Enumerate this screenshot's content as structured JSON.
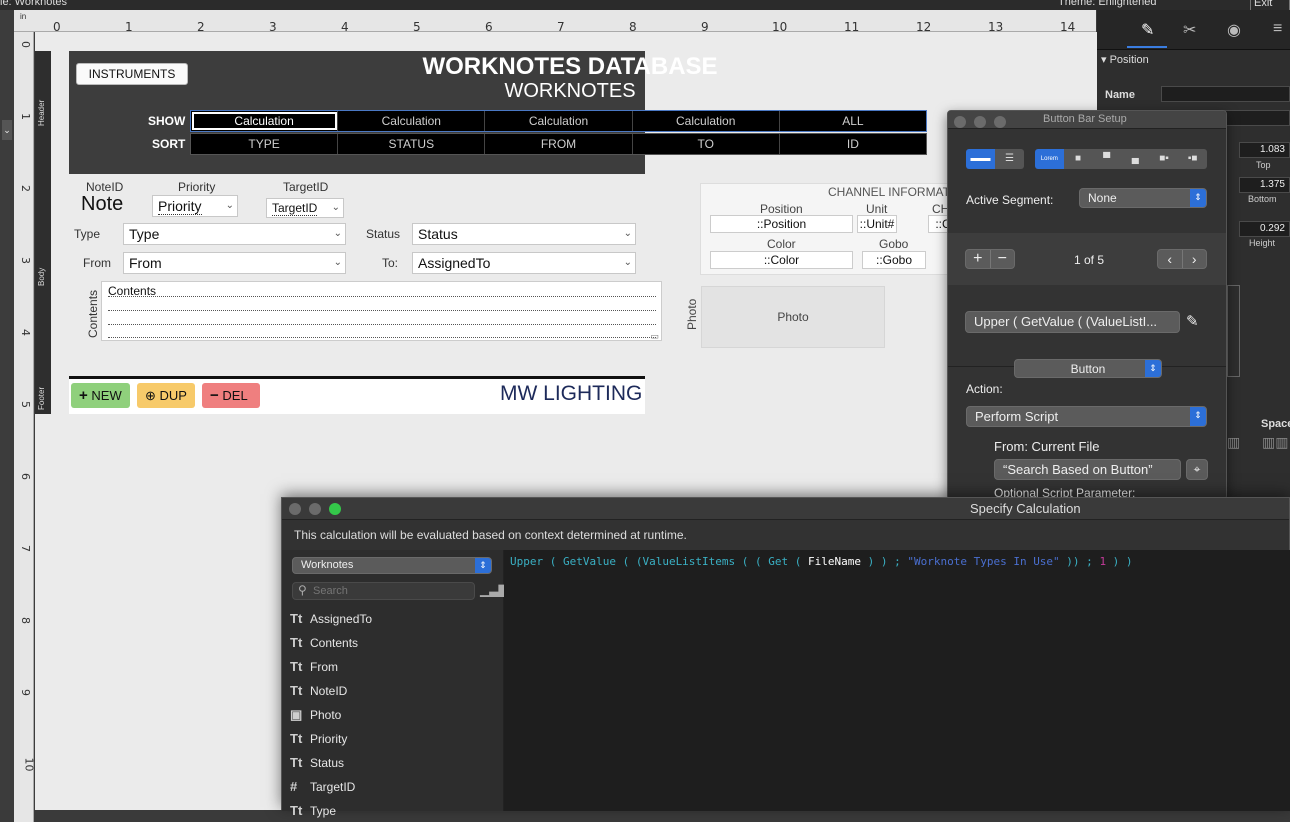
{
  "topbar": {
    "left_text": "le: Worknotes",
    "right_text": "Theme: Enlightened",
    "exit_label": "Exit La"
  },
  "ruler": {
    "unit": "in",
    "h_ticks": [
      "0",
      "1",
      "2",
      "3",
      "4",
      "5",
      "6",
      "7",
      "8",
      "9",
      "10",
      "11",
      "12",
      "13",
      "14"
    ],
    "v_ticks": [
      "0",
      "1",
      "2",
      "3",
      "4",
      "5",
      "6",
      "7",
      "8",
      "9",
      "10"
    ]
  },
  "parts": {
    "header": "Header",
    "body": "Body",
    "footer": "Footer"
  },
  "layout": {
    "instruments_label": "INSTRUMENTS",
    "title": "WORKNOTES DATABASE",
    "subtitle": "WORKNOTES",
    "show_label": "SHOW",
    "sort_label": "SORT",
    "show_buttons": [
      "Calculation",
      "Calculation",
      "Calculation",
      "Calculation",
      "ALL"
    ],
    "sort_buttons": [
      "TYPE",
      "STATUS",
      "FROM",
      "TO",
      "ID"
    ],
    "fields": {
      "noteid_label": "NoteID",
      "note_value": "Note",
      "priority_label": "Priority",
      "priority_value": "Priority",
      "targetid_label": "TargetID",
      "targetid_value": "TargetID",
      "type_label": "Type",
      "type_value": "Type",
      "status_label": "Status",
      "status_value": "Status",
      "from_label": "From",
      "from_value": "From",
      "to_label": "To:",
      "to_value": "AssignedTo",
      "contents_label": "Contents",
      "contents_value": "Contents"
    },
    "channel": {
      "title": "CHANNEL INFORMAT",
      "position_label": "Position",
      "position_value": "::Position",
      "unit_label": "Unit",
      "unit_value": "::Unit#",
      "ch_label": "CH",
      "ch_value": "::C",
      "color_label": "Color",
      "color_value": "::Color",
      "gobo_label": "Gobo",
      "gobo_value": "::Gobo"
    },
    "photo_label": "Photo",
    "photo_value": "Photo",
    "footer": {
      "new": "NEW",
      "dup": "DUP",
      "del": "DEL",
      "brand": "MW LIGHTING"
    }
  },
  "inspector": {
    "section": "Position",
    "name_label": "Name",
    "top_value": "1.083",
    "top_label": "Top",
    "bottom_value": "1.375",
    "bottom_label": "Bottom",
    "height_value": "0.292",
    "height_label": "Height",
    "space_label": "Space"
  },
  "button_bar_setup": {
    "title": "Button Bar Setup",
    "active_segment_label": "Active Segment:",
    "active_segment_value": "None",
    "segment_counter": "1 of 5",
    "calc_text": "Upper ( GetValue ( (ValueListI...",
    "button_type": "Button",
    "action_label": "Action:",
    "action_value": "Perform Script",
    "from_label": "From: Current File",
    "script_name": "“Search Based on Button”",
    "optional_param": "Optional Script Parameter:"
  },
  "specify_calc": {
    "title": "Specify Calculation",
    "info": "This calculation will be evaluated based on context determined at runtime.",
    "table": "Worknotes",
    "search_placeholder": "Search",
    "fields": [
      {
        "icon": "Tt",
        "name": "AssignedTo"
      },
      {
        "icon": "Tt",
        "name": "Contents"
      },
      {
        "icon": "Tt",
        "name": "From"
      },
      {
        "icon": "Tt",
        "name": "NoteID"
      },
      {
        "icon": "▣",
        "name": "Photo"
      },
      {
        "icon": "Tt",
        "name": "Priority"
      },
      {
        "icon": "Tt",
        "name": "Status"
      },
      {
        "icon": "#",
        "name": "TargetID"
      },
      {
        "icon": "Tt",
        "name": "Type"
      }
    ],
    "code": {
      "t1": "Upper ( GetValue ( (ValueListItems ( ( Get ( ",
      "t2": "FileName",
      "t3": " ) ) ; ",
      "t4": "\"Worknote Types In Use\"",
      "t5": " )) ; ",
      "t6": "1",
      "t7": " ) )"
    }
  }
}
